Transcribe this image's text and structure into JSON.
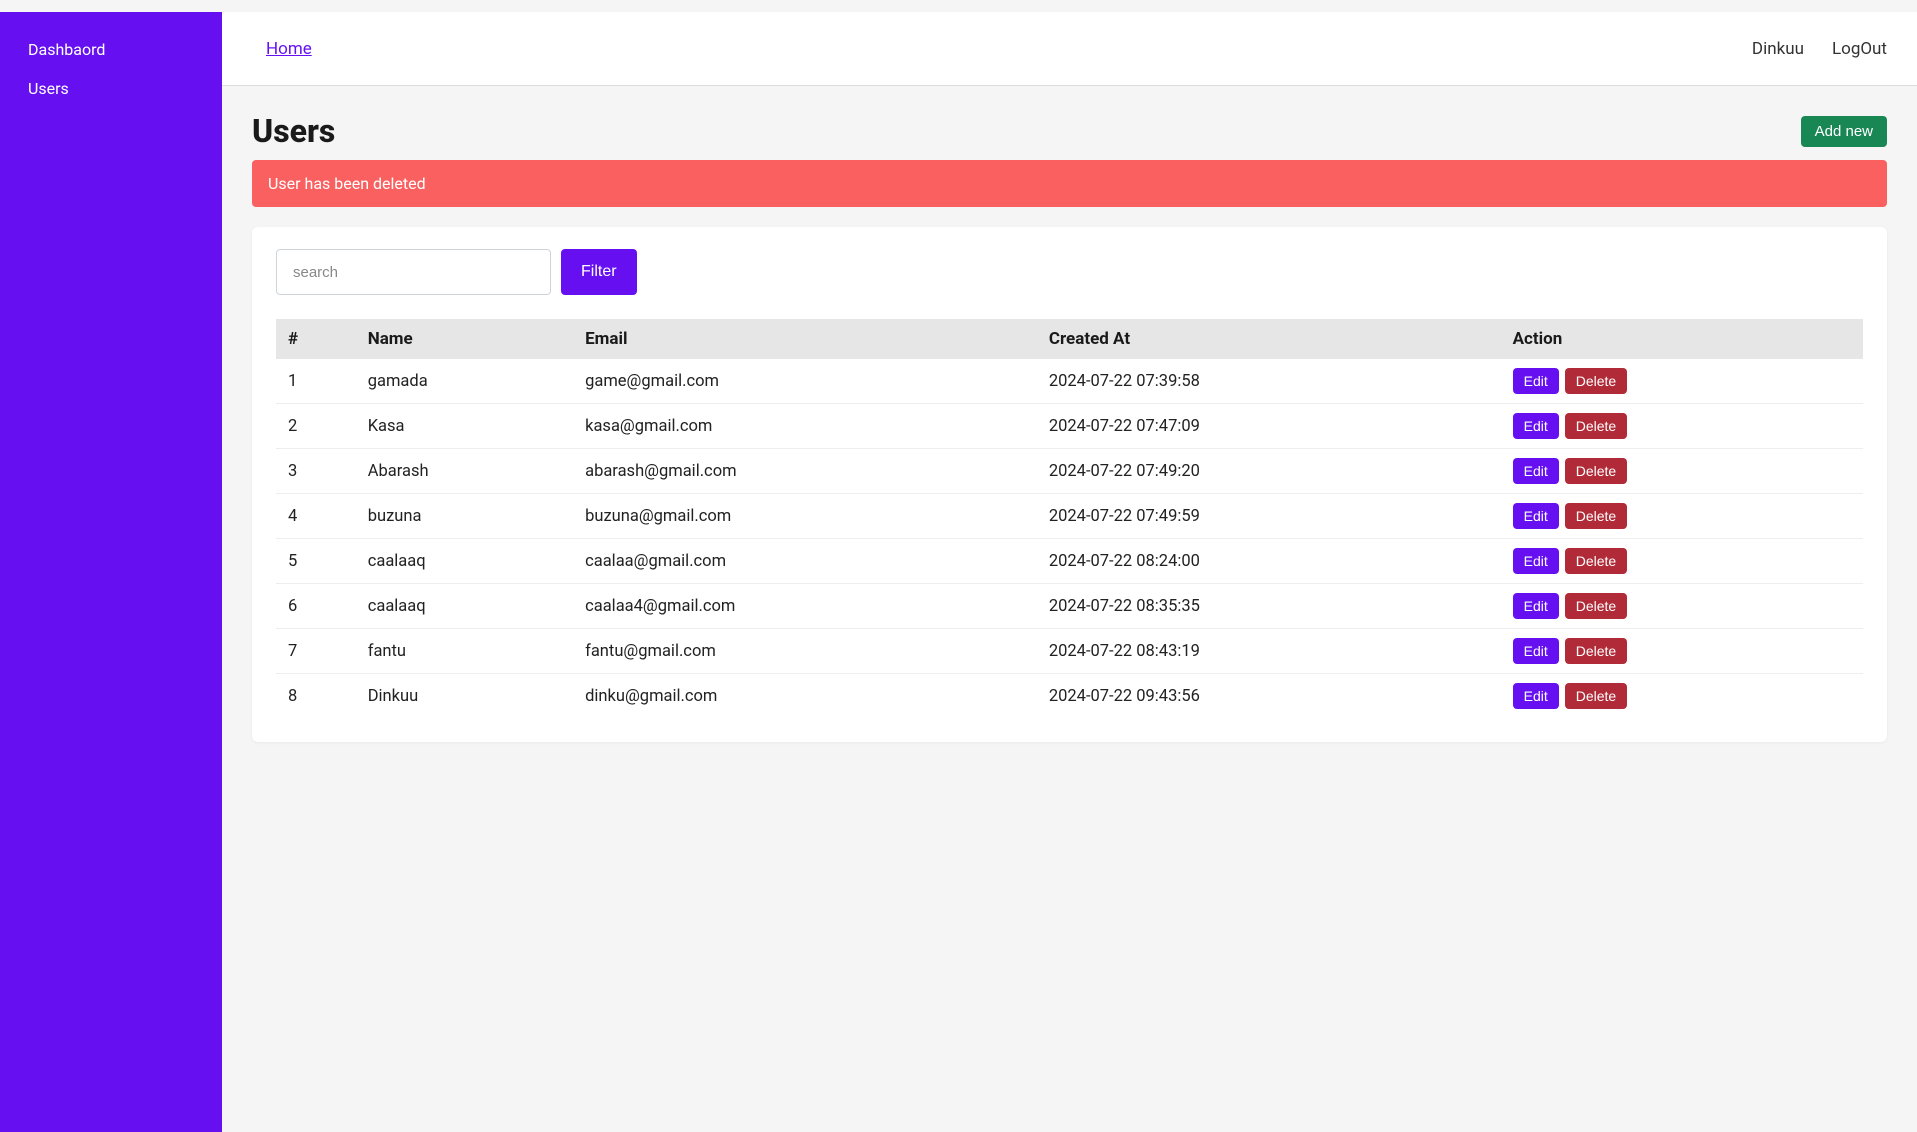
{
  "sidebar": {
    "items": [
      {
        "label": "Dashbaord"
      },
      {
        "label": "Users"
      }
    ]
  },
  "topnav": {
    "home_label": "Home",
    "user_label": "Dinkuu",
    "logout_label": "LogOut"
  },
  "page": {
    "title": "Users",
    "add_new_label": "Add new",
    "alert_message": "User has been deleted"
  },
  "filter": {
    "search_placeholder": "search",
    "search_value": "",
    "filter_button_label": "Filter"
  },
  "table": {
    "headers": {
      "idx": "#",
      "name": "Name",
      "email": "Email",
      "created_at": "Created At",
      "action": "Action"
    },
    "edit_label": "Edit",
    "delete_label": "Delete",
    "rows": [
      {
        "idx": "1",
        "name": "gamada",
        "email": "game@gmail.com",
        "created_at": "2024-07-22 07:39:58"
      },
      {
        "idx": "2",
        "name": "Kasa",
        "email": "kasa@gmail.com",
        "created_at": "2024-07-22 07:47:09"
      },
      {
        "idx": "3",
        "name": "Abarash",
        "email": "abarash@gmail.com",
        "created_at": "2024-07-22 07:49:20"
      },
      {
        "idx": "4",
        "name": "buzuna",
        "email": "buzuna@gmail.com",
        "created_at": "2024-07-22 07:49:59"
      },
      {
        "idx": "5",
        "name": "caalaaq",
        "email": "caalaa@gmail.com",
        "created_at": "2024-07-22 08:24:00"
      },
      {
        "idx": "6",
        "name": "caalaaq",
        "email": "caalaa4@gmail.com",
        "created_at": "2024-07-22 08:35:35"
      },
      {
        "idx": "7",
        "name": "fantu",
        "email": "fantu@gmail.com",
        "created_at": "2024-07-22 08:43:19"
      },
      {
        "idx": "8",
        "name": "Dinkuu",
        "email": "dinku@gmail.com",
        "created_at": "2024-07-22 09:43:56"
      }
    ]
  }
}
